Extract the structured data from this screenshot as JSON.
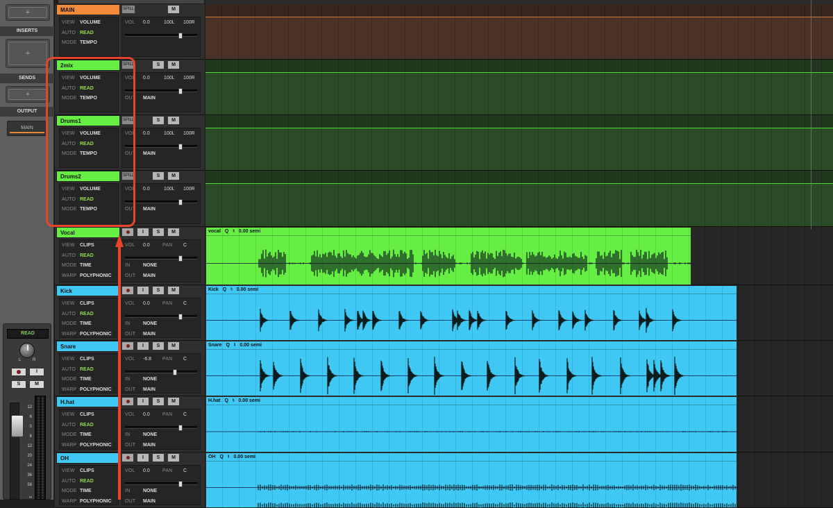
{
  "left_panel": {
    "inserts_label": "INSERTS",
    "sends_label": "SENDS",
    "output_label": "OUTPUT",
    "output_value": "MAIN",
    "add_symbol": "+",
    "auto_mode": "READ",
    "record_symbol": "",
    "input_symbol": "I",
    "solo_label": "S",
    "mute_label": "M",
    "knob_l": "L",
    "knob_r": "R",
    "scale": [
      "12",
      "6",
      "0",
      "6",
      "12",
      "20",
      "24",
      "36",
      "56",
      "∞"
    ]
  },
  "row_labels": {
    "view": "VIEW",
    "auto": "AUTO",
    "mode": "MODE",
    "warp": "WARP",
    "vol": "VOL",
    "pan": "PAN",
    "in": "IN",
    "out": "OUT"
  },
  "tracks": [
    {
      "name": "MAIN",
      "color": "#f28a3a",
      "type": "master",
      "spill": "SPILL",
      "mute": "M",
      "view": "VOLUME",
      "auto": "READ",
      "mode": "TEMPO",
      "vol": "0.0",
      "l": "100L",
      "r": "100R",
      "lane_color": "#4a3326"
    },
    {
      "name": "2mix",
      "color": "#66ee44",
      "type": "group",
      "spill": "SPILL",
      "solo": "S",
      "mute": "M",
      "view": "VOLUME",
      "auto": "READ",
      "mode": "TEMPO",
      "vol": "0.0",
      "l": "100L",
      "r": "100R",
      "out": "MAIN",
      "lane_color": "#2b4a27"
    },
    {
      "name": "Drums1",
      "color": "#66ee44",
      "type": "group",
      "spill": "SPILL",
      "solo": "S",
      "mute": "M",
      "view": "VOLUME",
      "auto": "READ",
      "mode": "TEMPO",
      "vol": "0.0",
      "l": "100L",
      "r": "100R",
      "out": "MAIN",
      "lane_color": "#2b4a27"
    },
    {
      "name": "Drums2",
      "color": "#66ee44",
      "type": "group",
      "spill": "SPILL",
      "solo": "S",
      "mute": "M",
      "view": "VOLUME",
      "auto": "READ",
      "mode": "TEMPO",
      "vol": "0.0",
      "l": "100L",
      "r": "100R",
      "out": "MAIN",
      "lane_color": "#2b4a27"
    },
    {
      "name": "Vocal",
      "color": "#66ee44",
      "type": "audio",
      "input": "I",
      "solo": "S",
      "mute": "M",
      "view": "CLIPS",
      "auto": "READ",
      "mode": "TIME",
      "warp": "POLYPHONIC",
      "vol": "0.0",
      "pan_val": "C",
      "in": "NONE",
      "out": "MAIN",
      "clip": {
        "name": "vocal",
        "q": "Q",
        "sym": "♮",
        "semi": "0.00 semi",
        "color": "#66ee44"
      }
    },
    {
      "name": "Kick",
      "color": "#3fc8f4",
      "type": "audio",
      "input": "I",
      "solo": "S",
      "mute": "M",
      "view": "CLIPS",
      "auto": "READ",
      "mode": "TIME",
      "warp": "POLYPHONIC",
      "vol": "0.0",
      "pan_val": "C",
      "in": "NONE",
      "out": "MAIN",
      "clip": {
        "name": "Kick",
        "q": "Q",
        "sym": "♮",
        "semi": "0.00 semi",
        "color": "#3fc8f4"
      }
    },
    {
      "name": "Snare",
      "color": "#3fc8f4",
      "type": "audio",
      "input": "I",
      "solo": "S",
      "mute": "M",
      "view": "CLIPS",
      "auto": "READ",
      "mode": "TIME",
      "warp": "POLYPHONIC",
      "vol": "-6.8",
      "pan_val": "C",
      "in": "NONE",
      "out": "MAIN",
      "clip": {
        "name": "Snare",
        "q": "Q",
        "sym": "♮",
        "semi": "0.00 semi",
        "color": "#3fc8f4"
      }
    },
    {
      "name": "H.hat",
      "color": "#3fc8f4",
      "type": "audio",
      "input": "I",
      "solo": "S",
      "mute": "M",
      "view": "CLIPS",
      "auto": "READ",
      "mode": "TIME",
      "warp": "POLYPHONIC",
      "vol": "0.0",
      "pan_val": "C",
      "in": "NONE",
      "out": "MAIN",
      "clip": {
        "name": "H.hat",
        "q": "Q",
        "sym": "♮",
        "semi": "0.00 semi",
        "color": "#3fc8f4"
      }
    },
    {
      "name": "OH",
      "color": "#3fc8f4",
      "type": "audio",
      "input": "I",
      "solo": "S",
      "mute": "M",
      "view": "CLIPS",
      "auto": "READ",
      "mode": "TIME",
      "warp": "POLYPHONIC",
      "vol": "0.0",
      "pan_val": "C",
      "in": "NONE",
      "out": "MAIN",
      "clip": {
        "name": "OH",
        "q": "Q",
        "sym": "♮",
        "semi": "0.00 semi",
        "color": "#3fc8f4"
      }
    }
  ]
}
